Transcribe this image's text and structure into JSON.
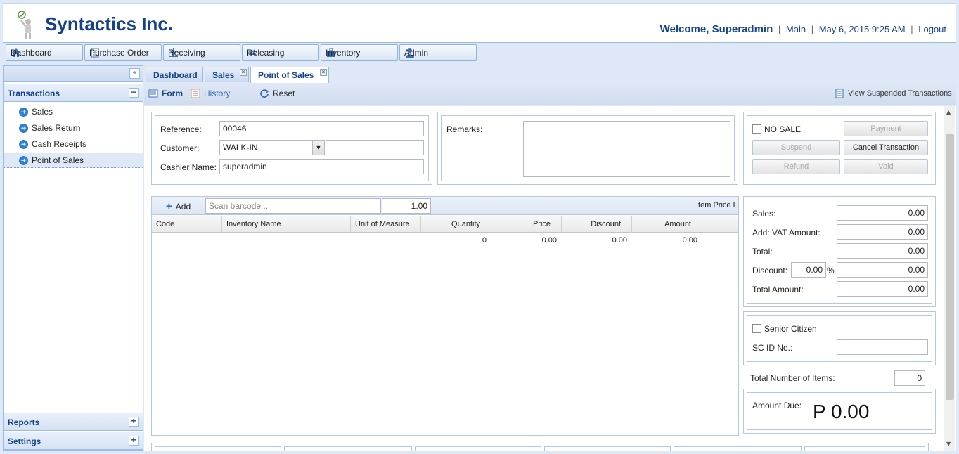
{
  "header": {
    "brand": "Syntactics Inc.",
    "welcome": "Welcome, Superadmin",
    "main_link": "Main",
    "datetime": "May 6, 2015 9:25 AM",
    "logout": "Logout"
  },
  "nav": {
    "items": [
      {
        "label": "Dashboard",
        "icon": "home-icon"
      },
      {
        "label": "Purchase Order",
        "icon": "document-icon"
      },
      {
        "label": "Receiving",
        "icon": "download-icon"
      },
      {
        "label": "Releasing",
        "icon": "refresh-icon"
      },
      {
        "label": "Inventory",
        "icon": "briefcase-icon"
      },
      {
        "label": "Admin",
        "icon": "user-icon"
      }
    ]
  },
  "sidebar": {
    "transactions_title": "Transactions",
    "items": [
      "Sales",
      "Sales Return",
      "Cash Receipts",
      "Point of Sales"
    ],
    "reports_title": "Reports",
    "settings_title": "Settings"
  },
  "tabs": [
    "Dashboard",
    "Sales",
    "Point of Sales"
  ],
  "toolbar": {
    "form": "Form",
    "history": "History",
    "reset": "Reset",
    "view_suspended": "View Suspended Transactions"
  },
  "form": {
    "reference_label": "Reference:",
    "reference_value": "00046",
    "customer_label": "Customer:",
    "customer_value": "WALK-IN",
    "cashier_label": "Cashier Name:",
    "cashier_value": "superadmin",
    "remarks_label": "Remarks:"
  },
  "actions": {
    "no_sale": "NO SALE",
    "payment": "Payment",
    "suspend": "Suspend",
    "cancel": "Cancel Transaction",
    "refund": "Refund",
    "void": "Void"
  },
  "grid": {
    "add": "Add",
    "barcode_placeholder": "Scan barcode...",
    "qty_value": "1.00",
    "item_price_label": "Item Price L",
    "columns": [
      "Code",
      "Inventory Name",
      "Unit of Measure",
      "Quantity",
      "Price",
      "Discount",
      "Amount"
    ],
    "totals": {
      "quantity": "0",
      "price": "0.00",
      "discount": "0.00",
      "amount": "0.00"
    }
  },
  "summary": {
    "sales_label": "Sales:",
    "sales": "0.00",
    "vat_label": "Add: VAT Amount:",
    "vat": "0.00",
    "total_label": "Total:",
    "total": "0.00",
    "discount_label": "Discount:",
    "discount_pct": "0.00",
    "pct": "%",
    "discount": "0.00",
    "total_amount_label": "Total Amount:",
    "total_amount": "0.00"
  },
  "senior": {
    "label": "Senior Citizen",
    "id_label": "SC ID No.:"
  },
  "items_count": {
    "label": "Total Number of Items:",
    "value": "0"
  },
  "amount_due": {
    "label": "Amount Due:",
    "value": "P 0.00"
  }
}
